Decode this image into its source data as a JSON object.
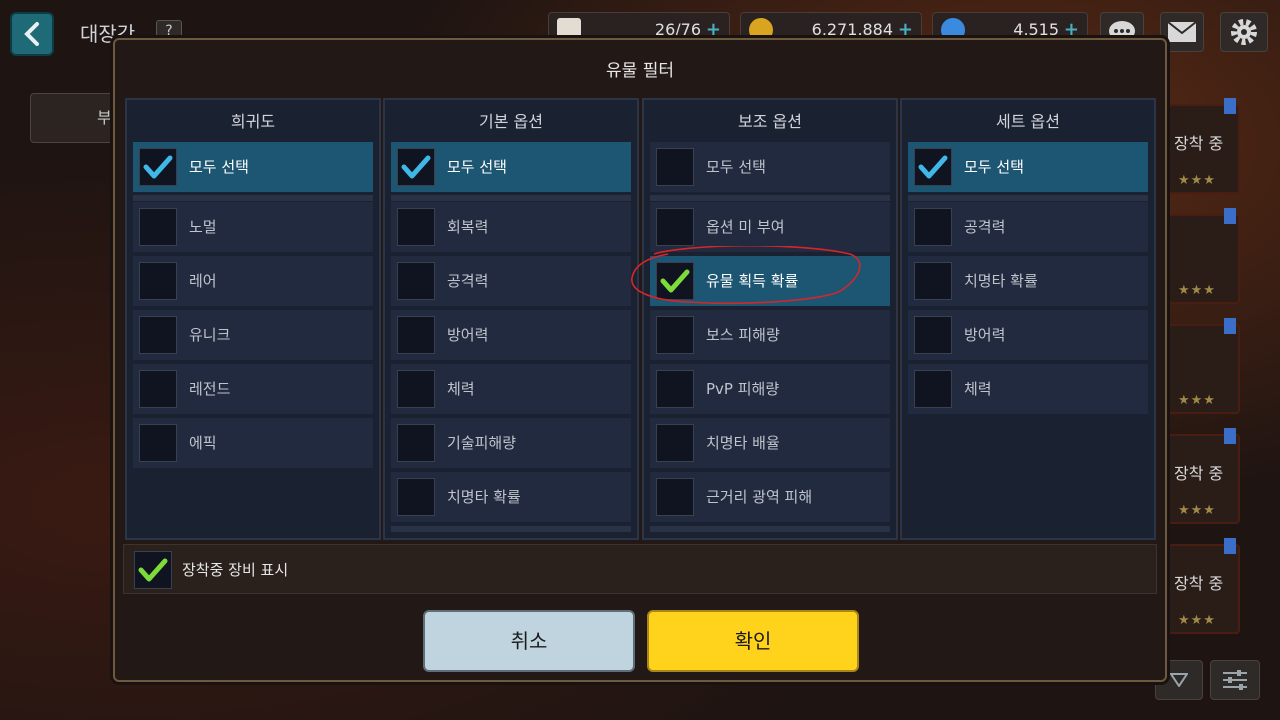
{
  "background": {
    "title": "대장간",
    "badge": "?",
    "resources": [
      {
        "name": "coffee-icon",
        "value": "26/76"
      },
      {
        "name": "gold-coin-icon",
        "value": "6,271,884"
      },
      {
        "name": "gem-icon",
        "value": "4,515"
      }
    ],
    "plus_label": "+",
    "side_cards": [
      {
        "label": "장착 중",
        "stars": "★★★"
      },
      {
        "label": "",
        "stars": "★★★"
      },
      {
        "label": "",
        "stars": "★★★"
      },
      {
        "label": "장착 중",
        "stars": "★★★"
      },
      {
        "label": "장착 중",
        "stars": "★★★"
      }
    ],
    "left_tab_fragment": "부"
  },
  "modal": {
    "title": "유물 필터",
    "columns": [
      {
        "header": "희귀도",
        "select_all": {
          "label": "모두 선택",
          "checked": true
        },
        "options": [
          {
            "label": "노멀",
            "checked": false
          },
          {
            "label": "레어",
            "checked": false
          },
          {
            "label": "유니크",
            "checked": false
          },
          {
            "label": "레전드",
            "checked": false
          },
          {
            "label": "에픽",
            "checked": false
          }
        ]
      },
      {
        "header": "기본 옵션",
        "select_all": {
          "label": "모두 선택",
          "checked": true
        },
        "options": [
          {
            "label": "회복력",
            "checked": false
          },
          {
            "label": "공격력",
            "checked": false
          },
          {
            "label": "방어력",
            "checked": false
          },
          {
            "label": "체력",
            "checked": false
          },
          {
            "label": "기술피해량",
            "checked": false
          },
          {
            "label": "치명타 확률",
            "checked": false
          }
        ]
      },
      {
        "header": "보조 옵션",
        "select_all": {
          "label": "모두 선택",
          "checked": false
        },
        "options": [
          {
            "label": "옵션 미 부여",
            "checked": false
          },
          {
            "label": "유물 획득 확률",
            "checked": true
          },
          {
            "label": "보스 피해량",
            "checked": false
          },
          {
            "label": "PvP 피해량",
            "checked": false
          },
          {
            "label": "치명타 배율",
            "checked": false
          },
          {
            "label": "근거리 광역 피해",
            "checked": false
          }
        ]
      },
      {
        "header": "세트 옵션",
        "select_all": {
          "label": "모두 선택",
          "checked": true
        },
        "options": [
          {
            "label": "공격력",
            "checked": false
          },
          {
            "label": "치명타 확률",
            "checked": false
          },
          {
            "label": "방어력",
            "checked": false
          },
          {
            "label": "체력",
            "checked": false
          }
        ]
      }
    ],
    "show_equipped": {
      "label": "장착중 장비 표시",
      "checked": true
    },
    "cancel_label": "취소",
    "confirm_label": "확인"
  },
  "colors": {
    "check_blue": "#3fb8e8",
    "check_green": "#7ddc3a",
    "selected_row": "#1d5673",
    "confirm": "#ffd21c",
    "cancel": "#c0d4e0",
    "annotation": "#d6262a"
  }
}
